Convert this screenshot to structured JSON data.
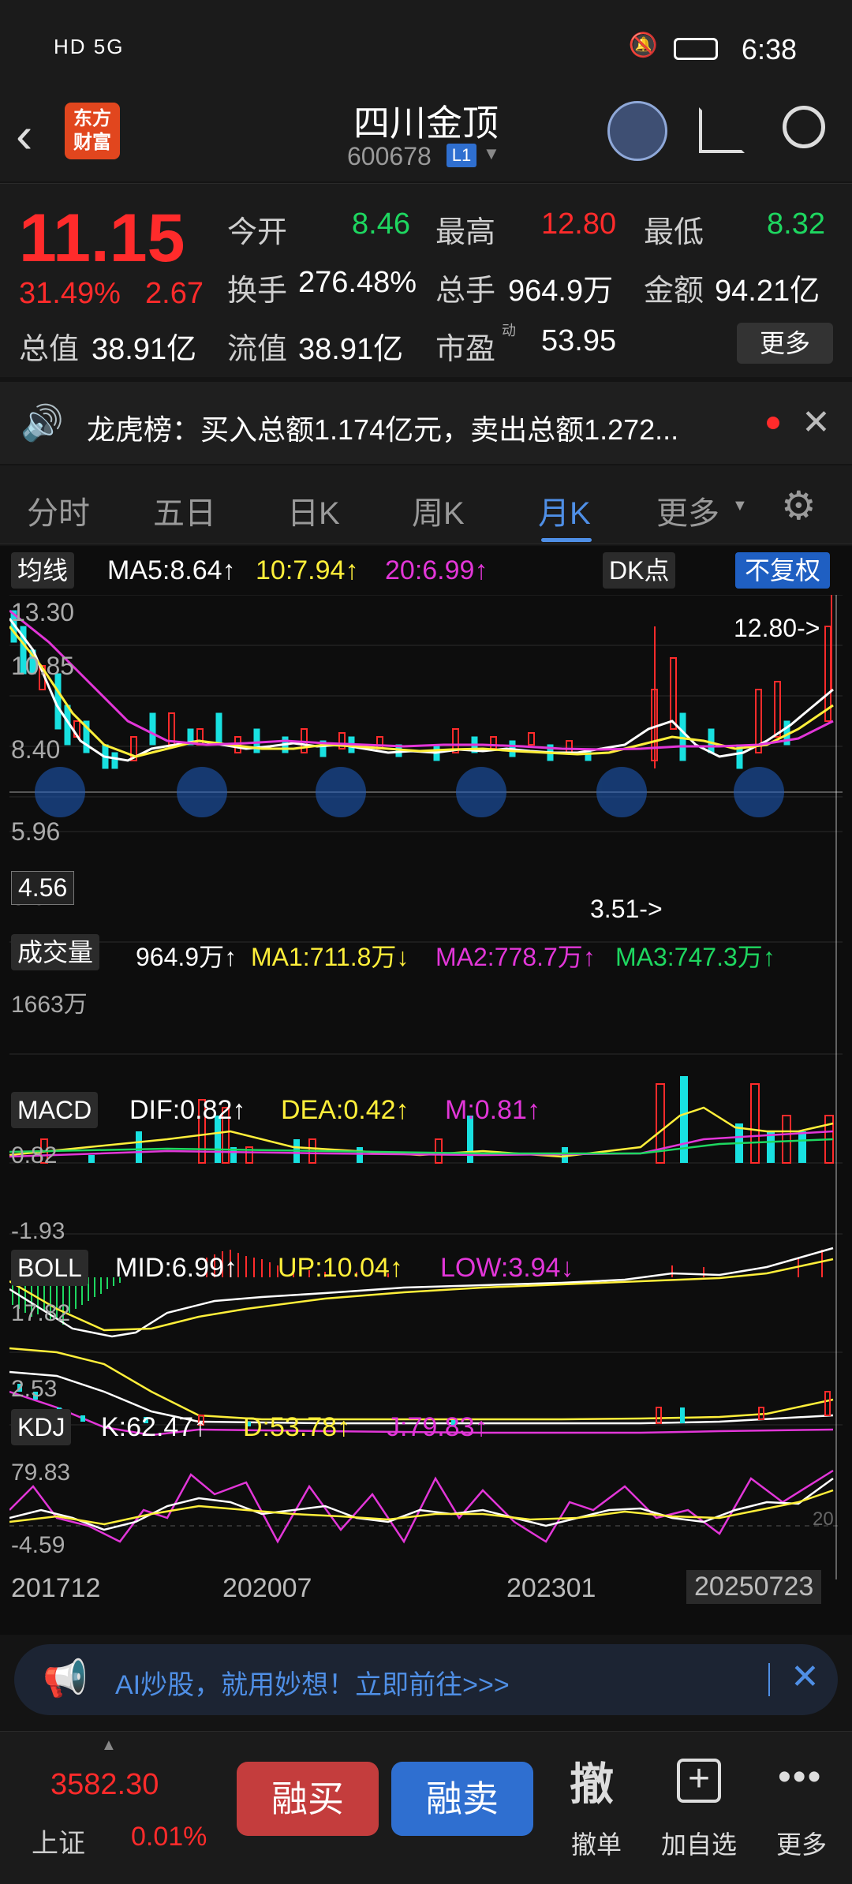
{
  "status_bar": {
    "time": "6:38",
    "left_icons": "HD 5G"
  },
  "header": {
    "title": "四川金顶",
    "code": "600678",
    "level": "L1",
    "brand": "东方\n财富"
  },
  "quote": {
    "price": "11.15",
    "change_pct": "31.49%",
    "change": "2.67",
    "open_label": "今开",
    "open": "8.46",
    "high_label": "最高",
    "high": "12.80",
    "low_label": "最低",
    "low": "8.32",
    "turnover_label": "换手",
    "turnover": "276.48%",
    "volume_label": "总手",
    "volume": "964.9万",
    "amount_label": "金额",
    "amount": "94.21亿",
    "mktcap_label": "总值",
    "mktcap": "38.91亿",
    "float_label": "流值",
    "float": "38.91亿",
    "pe_label": "市盈",
    "pe_sup": "动",
    "pe": "53.95",
    "more": "更多"
  },
  "notice": {
    "text": "龙虎榜：买入总额1.174亿元，卖出总额1.272..."
  },
  "tabs": [
    "分时",
    "五日",
    "日K",
    "周K",
    "月K",
    "更多"
  ],
  "chart": {
    "ma_label": "均线",
    "ma5": "MA5:8.64↑",
    "ma10": "10:7.94↑",
    "ma20": "20:6.99↑",
    "dk": "DK点",
    "fq": "不复权",
    "price_ticks": [
      "13.30",
      "10.85",
      "8.40",
      "5.96",
      "3.51"
    ],
    "crosshair_price": "4.56",
    "high_mark": "12.80->",
    "low_mark": "3.51->",
    "vol_label": "成交量",
    "vol": "964.9万↑",
    "vol_ma1": "MA1:711.8万↓",
    "vol_ma2": "MA2:778.7万↑",
    "vol_ma3": "MA3:747.3万↑",
    "vol_tick": "1663万",
    "macd_label": "MACD",
    "dif": "DIF:0.82↑",
    "dea": "DEA:0.42↑",
    "m": "M:0.81↑",
    "macd_ticks": [
      "0.82",
      "-1.93"
    ],
    "boll_label": "BOLL",
    "mid": "MID:6.99↑",
    "up": "UP:10.04↑",
    "low": "LOW:3.94↓",
    "boll_ticks": [
      "17.82",
      "2.53"
    ],
    "kdj_label": "KDJ",
    "k": "K:62.47↑",
    "d": "D:53.78↑",
    "j": "J:79.83↑",
    "kdj_ticks": [
      "79.83",
      "-4.59",
      "20"
    ],
    "dates": [
      "201712",
      "202007",
      "202301",
      "20250723"
    ]
  },
  "ai_banner": {
    "text": "AI炒股，就用妙想！立即前往>>>"
  },
  "bottom": {
    "index_value": "3582.30",
    "index_name": "上证",
    "index_pct": "0.01%",
    "buy": "融买",
    "sell": "融卖",
    "cancel_icon": "撤",
    "cancel": "撤单",
    "add": "加自选",
    "more": "更多"
  },
  "colors": {
    "red": "#ff2b2b",
    "green": "#1ed760",
    "cyan": "#18e0e0",
    "yellow": "#ffef3a",
    "magenta": "#e236d8",
    "blue": "#4f8fe6"
  }
}
